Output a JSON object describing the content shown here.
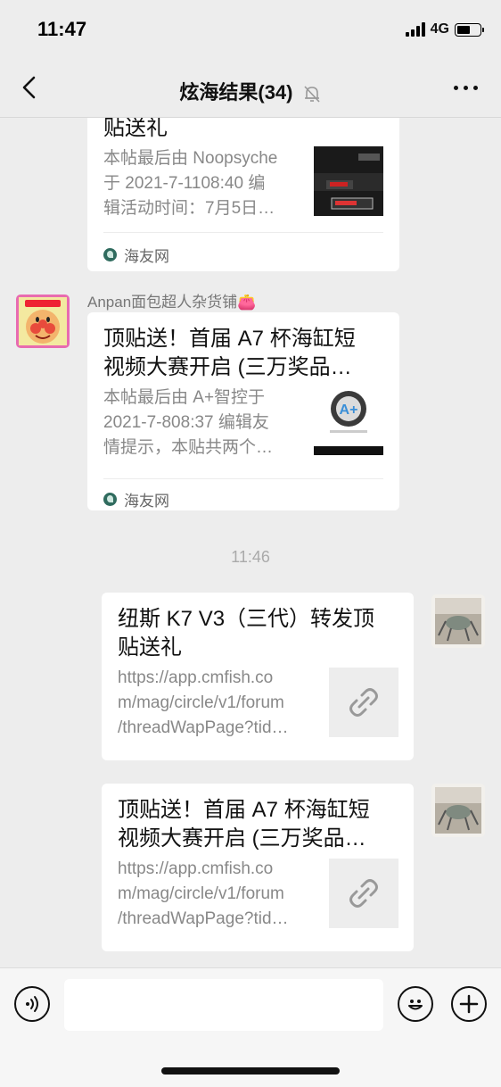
{
  "status_bar": {
    "time": "11:47",
    "network": "4G"
  },
  "nav": {
    "title": "炫海结果(34)"
  },
  "messages": [
    {
      "title": "贴送礼",
      "desc": [
        "本帖最后由 Noopsyche",
        "于 2021-7-1108:40 编",
        "辑活动时间：7月5日…"
      ],
      "source": "海友网"
    },
    {
      "sender": "Anpan面包超人杂货铺👛",
      "title": [
        "顶贴送！首届 A7 杯海缸短",
        "视频大赛开启 (三万奖品…"
      ],
      "desc": [
        "本帖最后由 A+智控于",
        "2021-7-808:37 编辑友",
        "情提示，本贴共两个…"
      ],
      "source": "海友网"
    }
  ],
  "time_divider": "11:46",
  "outgoing": [
    {
      "title": [
        "纽斯 K7 V3（三代）转发顶",
        "贴送礼"
      ],
      "url": [
        "https://app.cmfish.co",
        "m/mag/circle/v1/forum",
        "/threadWapPage?tid…"
      ]
    },
    {
      "title": [
        "顶贴送！首届 A7 杯海缸短",
        "视频大赛开启 (三万奖品…"
      ],
      "url": [
        "https://app.cmfish.co",
        "m/mag/circle/v1/forum",
        "/threadWapPage?tid…"
      ]
    }
  ]
}
